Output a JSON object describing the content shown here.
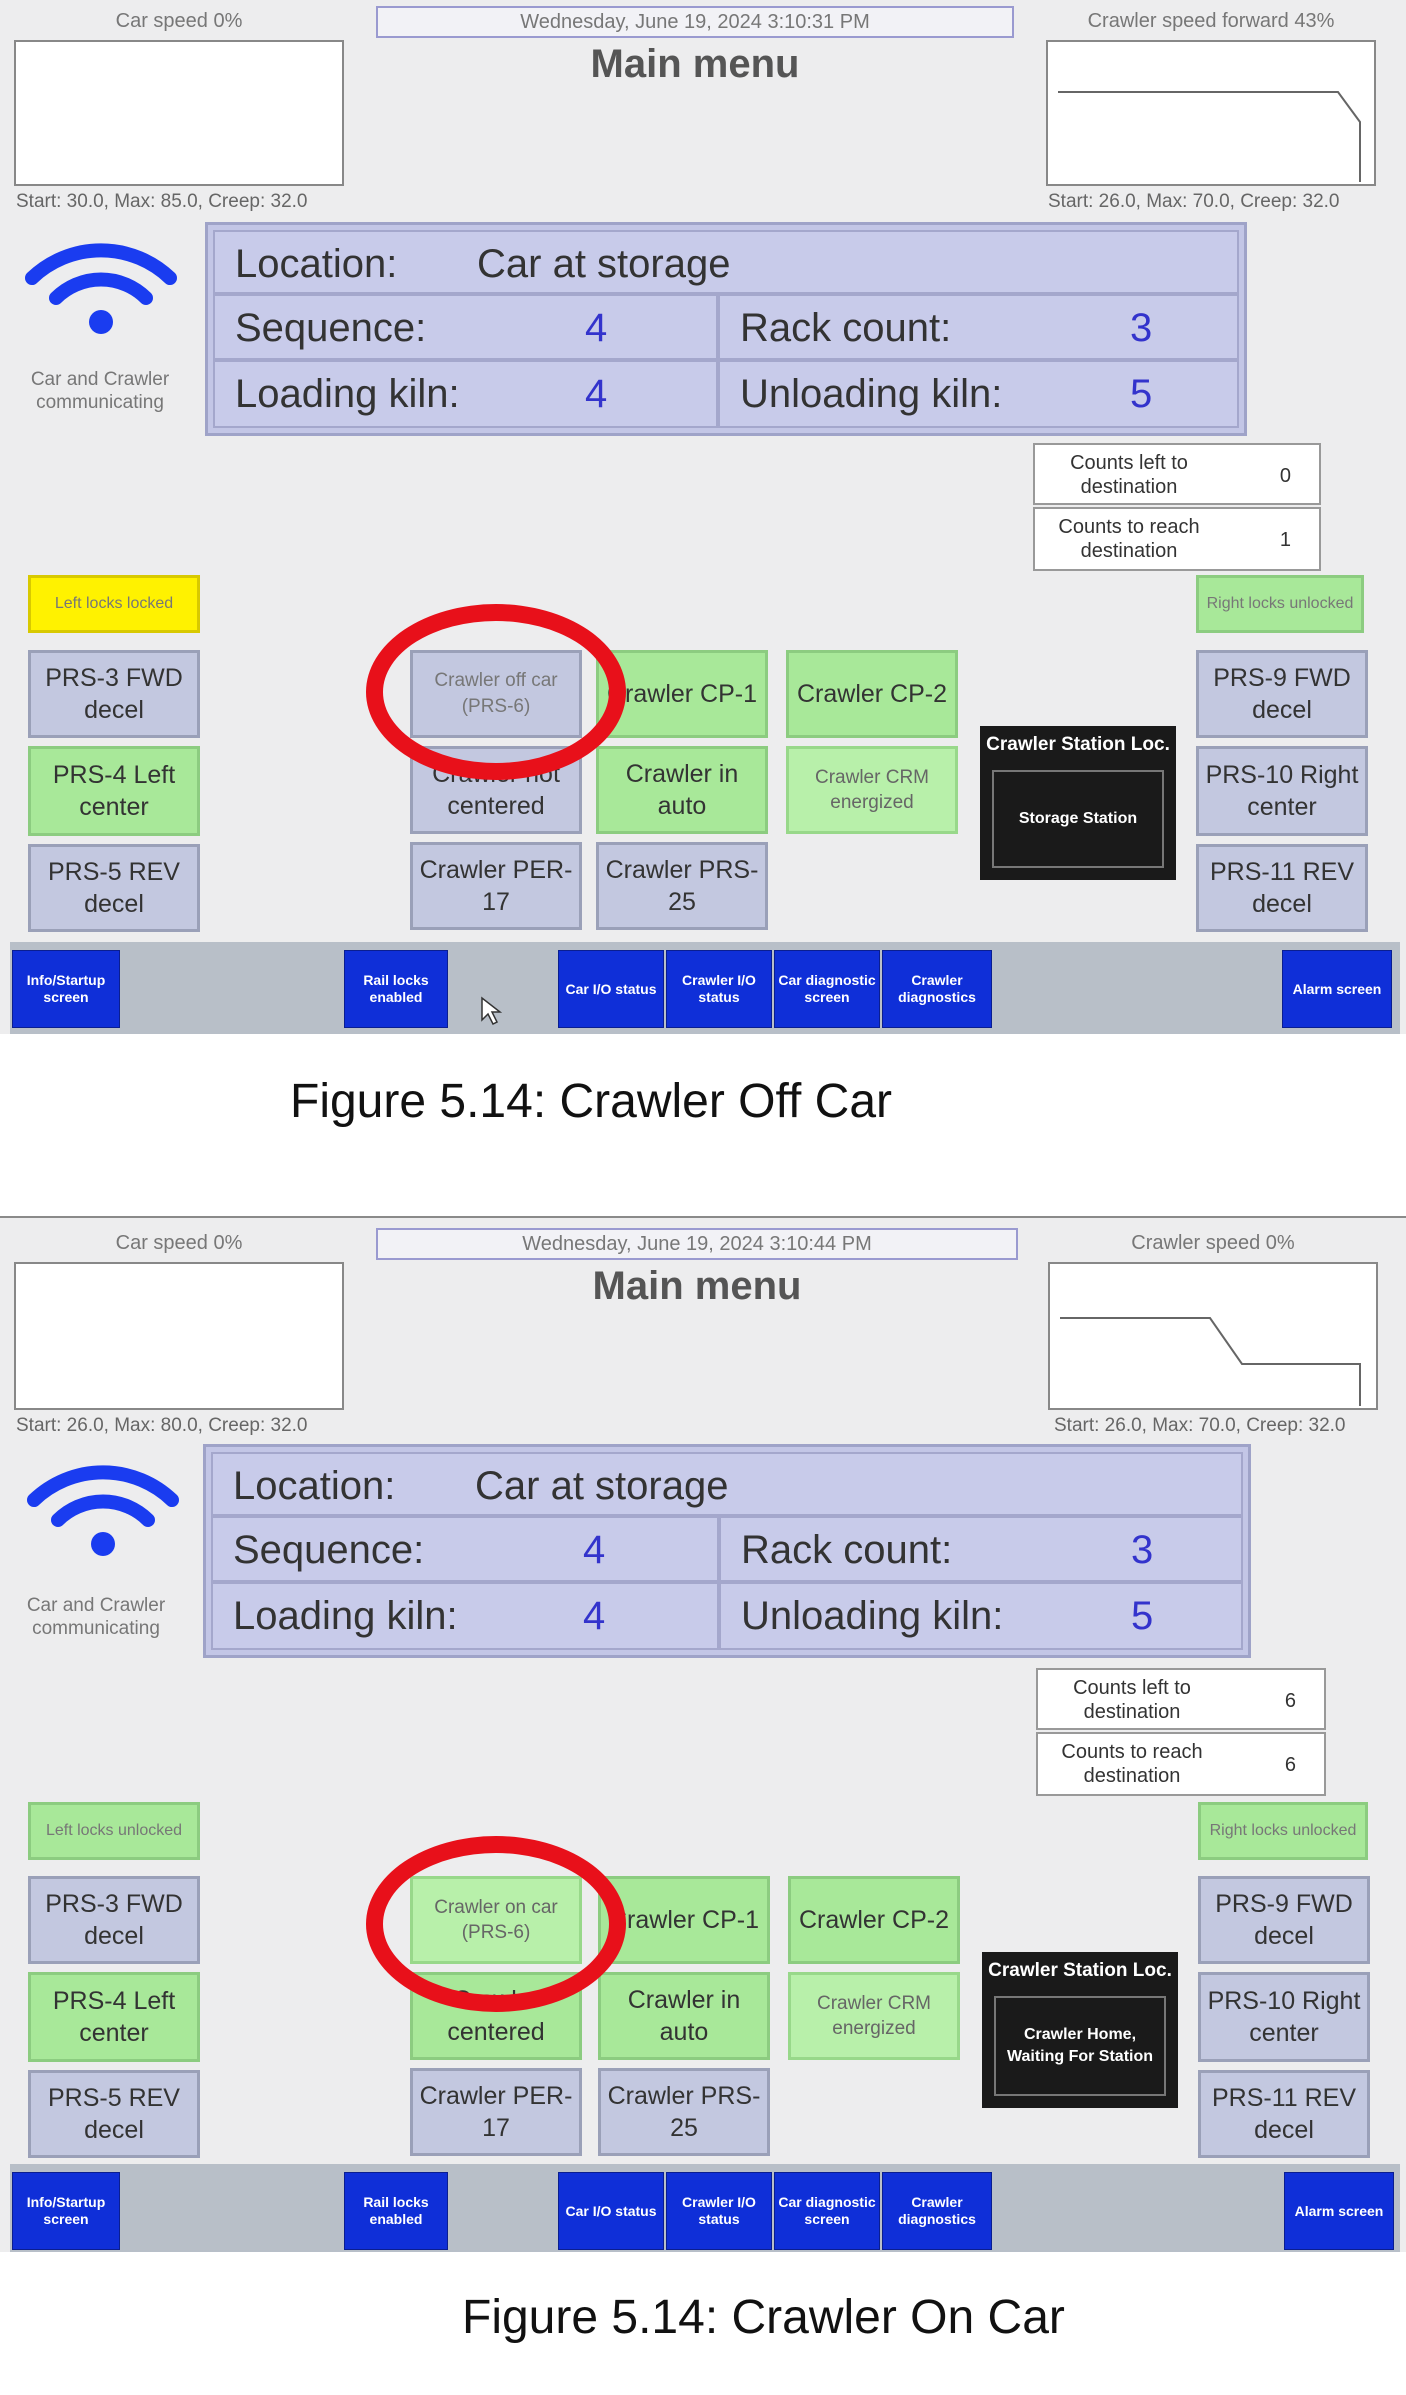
{
  "screens": [
    {
      "car_speed": "Car speed 0%",
      "crawler_speed": "Crawler speed forward 43%",
      "datetime": "Wednesday, June 19, 2024 3:10:31 PM",
      "title": "Main menu",
      "car_start": "Start: 30.0, Max: 85.0, Creep: 32.0",
      "crawler_start": "Start: 26.0, Max: 70.0, Creep: 32.0",
      "comm_status": "Car and Crawler communicating",
      "location_label": "Location:",
      "location_value": "Car at storage",
      "sequence_label": "Sequence:",
      "sequence_value": "4",
      "rack_count_label": "Rack count:",
      "rack_count_value": "3",
      "loading_kiln_label": "Loading kiln:",
      "loading_kiln_value": "4",
      "unloading_kiln_label": "Unloading kiln:",
      "unloading_kiln_value": "5",
      "counts_left_label": "Counts left to destination",
      "counts_left_value": "0",
      "counts_reach_label": "Counts to reach destination",
      "counts_reach_value": "1",
      "left_locks": "Left locks locked",
      "right_locks": "Right locks unlocked",
      "prs3": "PRS-3 FWD decel",
      "prs4": "PRS-4 Left center",
      "prs5": "PRS-5 REV decel",
      "crawler_prs6": "Crawler off car (PRS-6)",
      "crawler_centered": "Crawler not centered",
      "crawler_per17": "Crawler PER-17",
      "crawler_cp1": "Crawler CP-1",
      "crawler_auto": "Crawler in auto",
      "crawler_prs25": "Crawler PRS-25",
      "crawler_cp2": "Crawler CP-2",
      "crawler_crm": "Crawler CRM energized",
      "station_header": "Crawler Station Loc.",
      "station_value": "Storage Station",
      "prs9": "PRS-9 FWD decel",
      "prs10": "PRS-10 Right center",
      "prs11": "PRS-11 REV decel",
      "nav": {
        "info": "Info/Startup screen",
        "rail_locks": "Rail locks enabled",
        "car_io": "Car I/O status",
        "crawler_io": "Crawler I/O status",
        "car_diag": "Car diagnostic screen",
        "crawler_diag": "Crawler diagnostics",
        "alarm": "Alarm screen"
      },
      "caption": "Figure 5.14: Crawler Off Car"
    },
    {
      "car_speed": "Car speed 0%",
      "crawler_speed": "Crawler speed 0%",
      "datetime": "Wednesday, June 19, 2024 3:10:44 PM",
      "title": "Main menu",
      "car_start": "Start: 26.0, Max: 80.0, Creep: 32.0",
      "crawler_start": "Start: 26.0, Max: 70.0, Creep: 32.0",
      "comm_status": "Car and Crawler communicating",
      "location_label": "Location:",
      "location_value": "Car at storage",
      "sequence_label": "Sequence:",
      "sequence_value": "4",
      "rack_count_label": "Rack count:",
      "rack_count_value": "3",
      "loading_kiln_label": "Loading kiln:",
      "loading_kiln_value": "4",
      "unloading_kiln_label": "Unloading kiln:",
      "unloading_kiln_value": "5",
      "counts_left_label": "Counts left to destination",
      "counts_left_value": "6",
      "counts_reach_label": "Counts to reach destination",
      "counts_reach_value": "6",
      "left_locks": "Left locks unlocked",
      "right_locks": "Right locks unlocked",
      "prs3": "PRS-3 FWD decel",
      "prs4": "PRS-4 Left center",
      "prs5": "PRS-5 REV decel",
      "crawler_prs6": "Crawler on car (PRS-6)",
      "crawler_centered": "Crawler centered",
      "crawler_per17": "Crawler PER-17",
      "crawler_cp1": "Crawler CP-1",
      "crawler_auto": "Crawler in auto",
      "crawler_prs25": "Crawler PRS-25",
      "crawler_cp2": "Crawler CP-2",
      "crawler_crm": "Crawler CRM energized",
      "station_header": "Crawler Station Loc.",
      "station_value": "Crawler Home, Waiting For Station",
      "prs9": "PRS-9 FWD decel",
      "prs10": "PRS-10 Right center",
      "prs11": "PRS-11 REV decel",
      "nav": {
        "info": "Info/Startup screen",
        "rail_locks": "Rail locks enabled",
        "car_io": "Car I/O status",
        "crawler_io": "Crawler I/O status",
        "car_diag": "Car diagnostic screen",
        "crawler_diag": "Crawler diagnostics",
        "alarm": "Alarm screen"
      },
      "caption": "Figure 5.14: Crawler On Car"
    }
  ],
  "colors": {
    "button_blue": "#c3c8e0",
    "button_green": "#a8e899",
    "lock_yellow": "#fff200",
    "nav_blue": "#0f2fd8",
    "highlight_red": "#e8101a",
    "wifi_blue": "#1a3cf0"
  },
  "icons": [
    "wifi-icon",
    "mouse-cursor-icon"
  ]
}
